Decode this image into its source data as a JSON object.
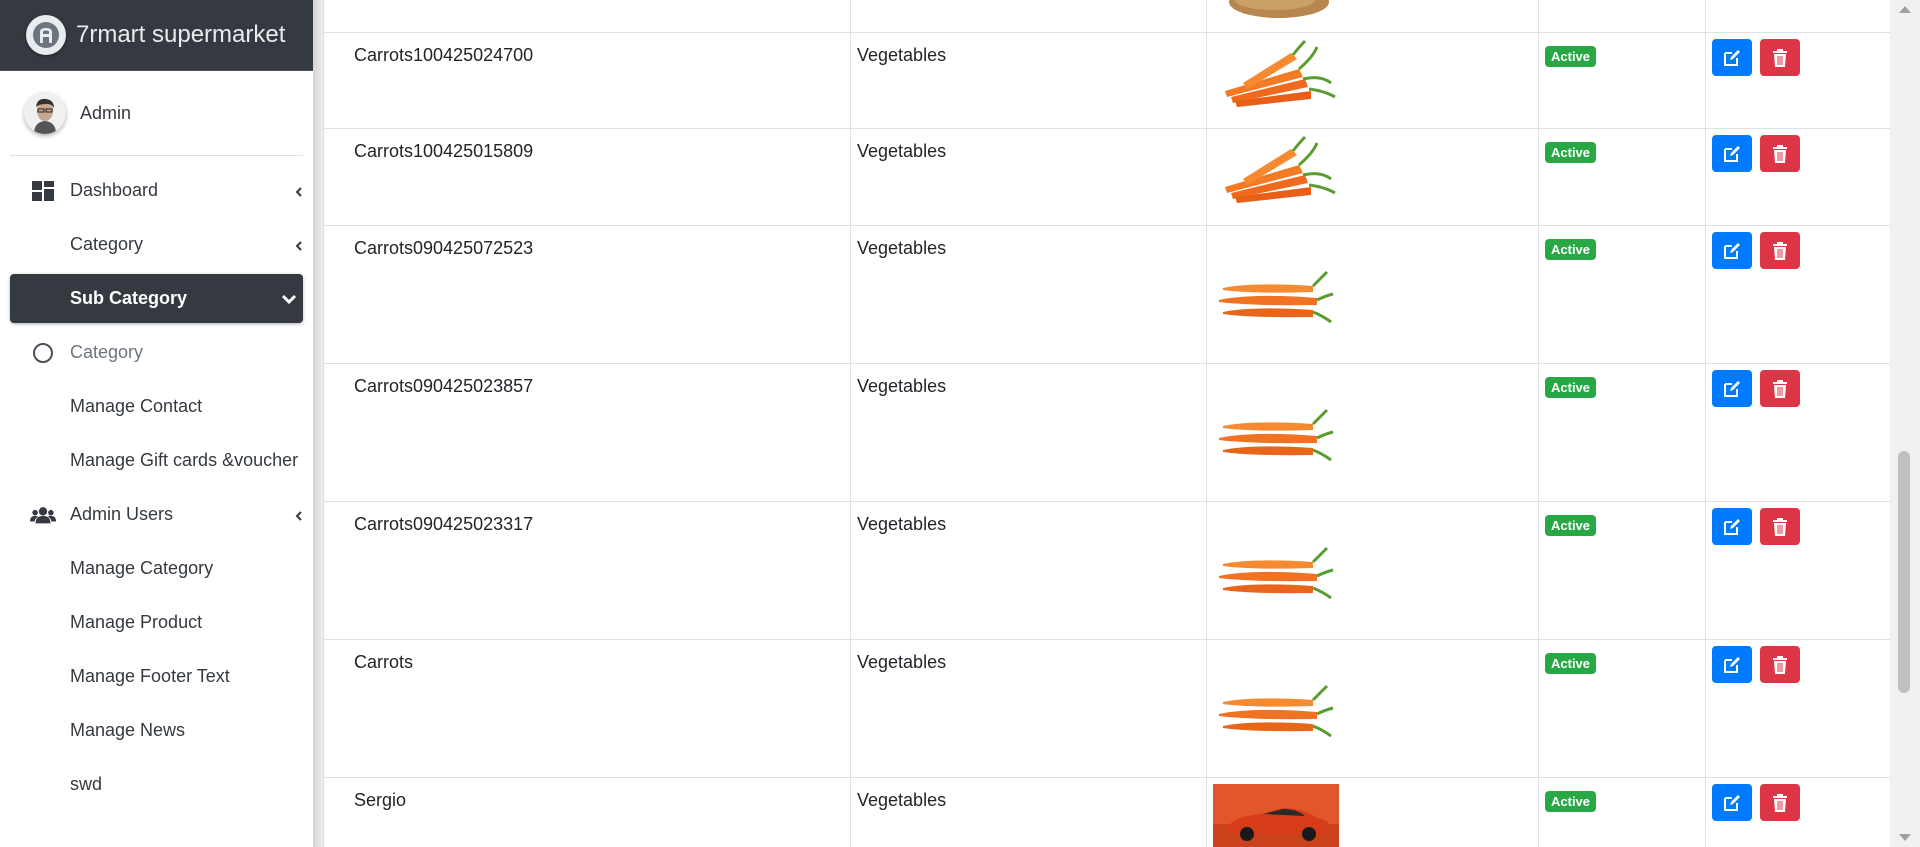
{
  "brand": {
    "name": "7rmart supermarket",
    "logo_icon": "admin-logo-icon"
  },
  "user": {
    "name": "Admin"
  },
  "sidebar": {
    "items": [
      {
        "label": "Dashboard",
        "icon": "dashboard-icon",
        "arrow": true
      },
      {
        "label": "Category",
        "arrow": true
      },
      {
        "label": "Sub Category",
        "active": true,
        "arrow": true
      },
      {
        "label": "Category",
        "icon": "circle-icon",
        "muted": true
      },
      {
        "label": "Manage Contact"
      },
      {
        "label": "Manage Gift cards &voucher"
      },
      {
        "label": "Admin Users",
        "icon": "users-icon",
        "arrow": true
      },
      {
        "label": "Manage Category"
      },
      {
        "label": "Manage Product"
      },
      {
        "label": "Manage Footer Text"
      },
      {
        "label": "Manage News"
      },
      {
        "label": "swd"
      }
    ]
  },
  "table": {
    "rows": [
      {
        "title": "Carrots100425024700",
        "category": "Vegetables",
        "image": "carrot-bunch-image",
        "status": "Active"
      },
      {
        "title": "Carrots100425015809",
        "category": "Vegetables",
        "image": "carrot-bunch-image",
        "status": "Active"
      },
      {
        "title": "Carrots090425072523",
        "category": "Vegetables",
        "image": "carrots-image",
        "status": "Active"
      },
      {
        "title": "Carrots090425023857",
        "category": "Vegetables",
        "image": "carrots-image",
        "status": "Active"
      },
      {
        "title": "Carrots090425023317",
        "category": "Vegetables",
        "image": "carrots-image",
        "status": "Active"
      },
      {
        "title": "Carrots",
        "category": "Vegetables",
        "image": "carrots-image",
        "status": "Active"
      },
      {
        "title": "Sergio",
        "category": "Vegetables",
        "image": "sports-car-image",
        "status": "Active"
      }
    ]
  },
  "colors": {
    "sidebar_dark": "#343a40",
    "active_badge": "#28a745",
    "edit_button": "#007bff",
    "delete_button": "#dc3545"
  }
}
